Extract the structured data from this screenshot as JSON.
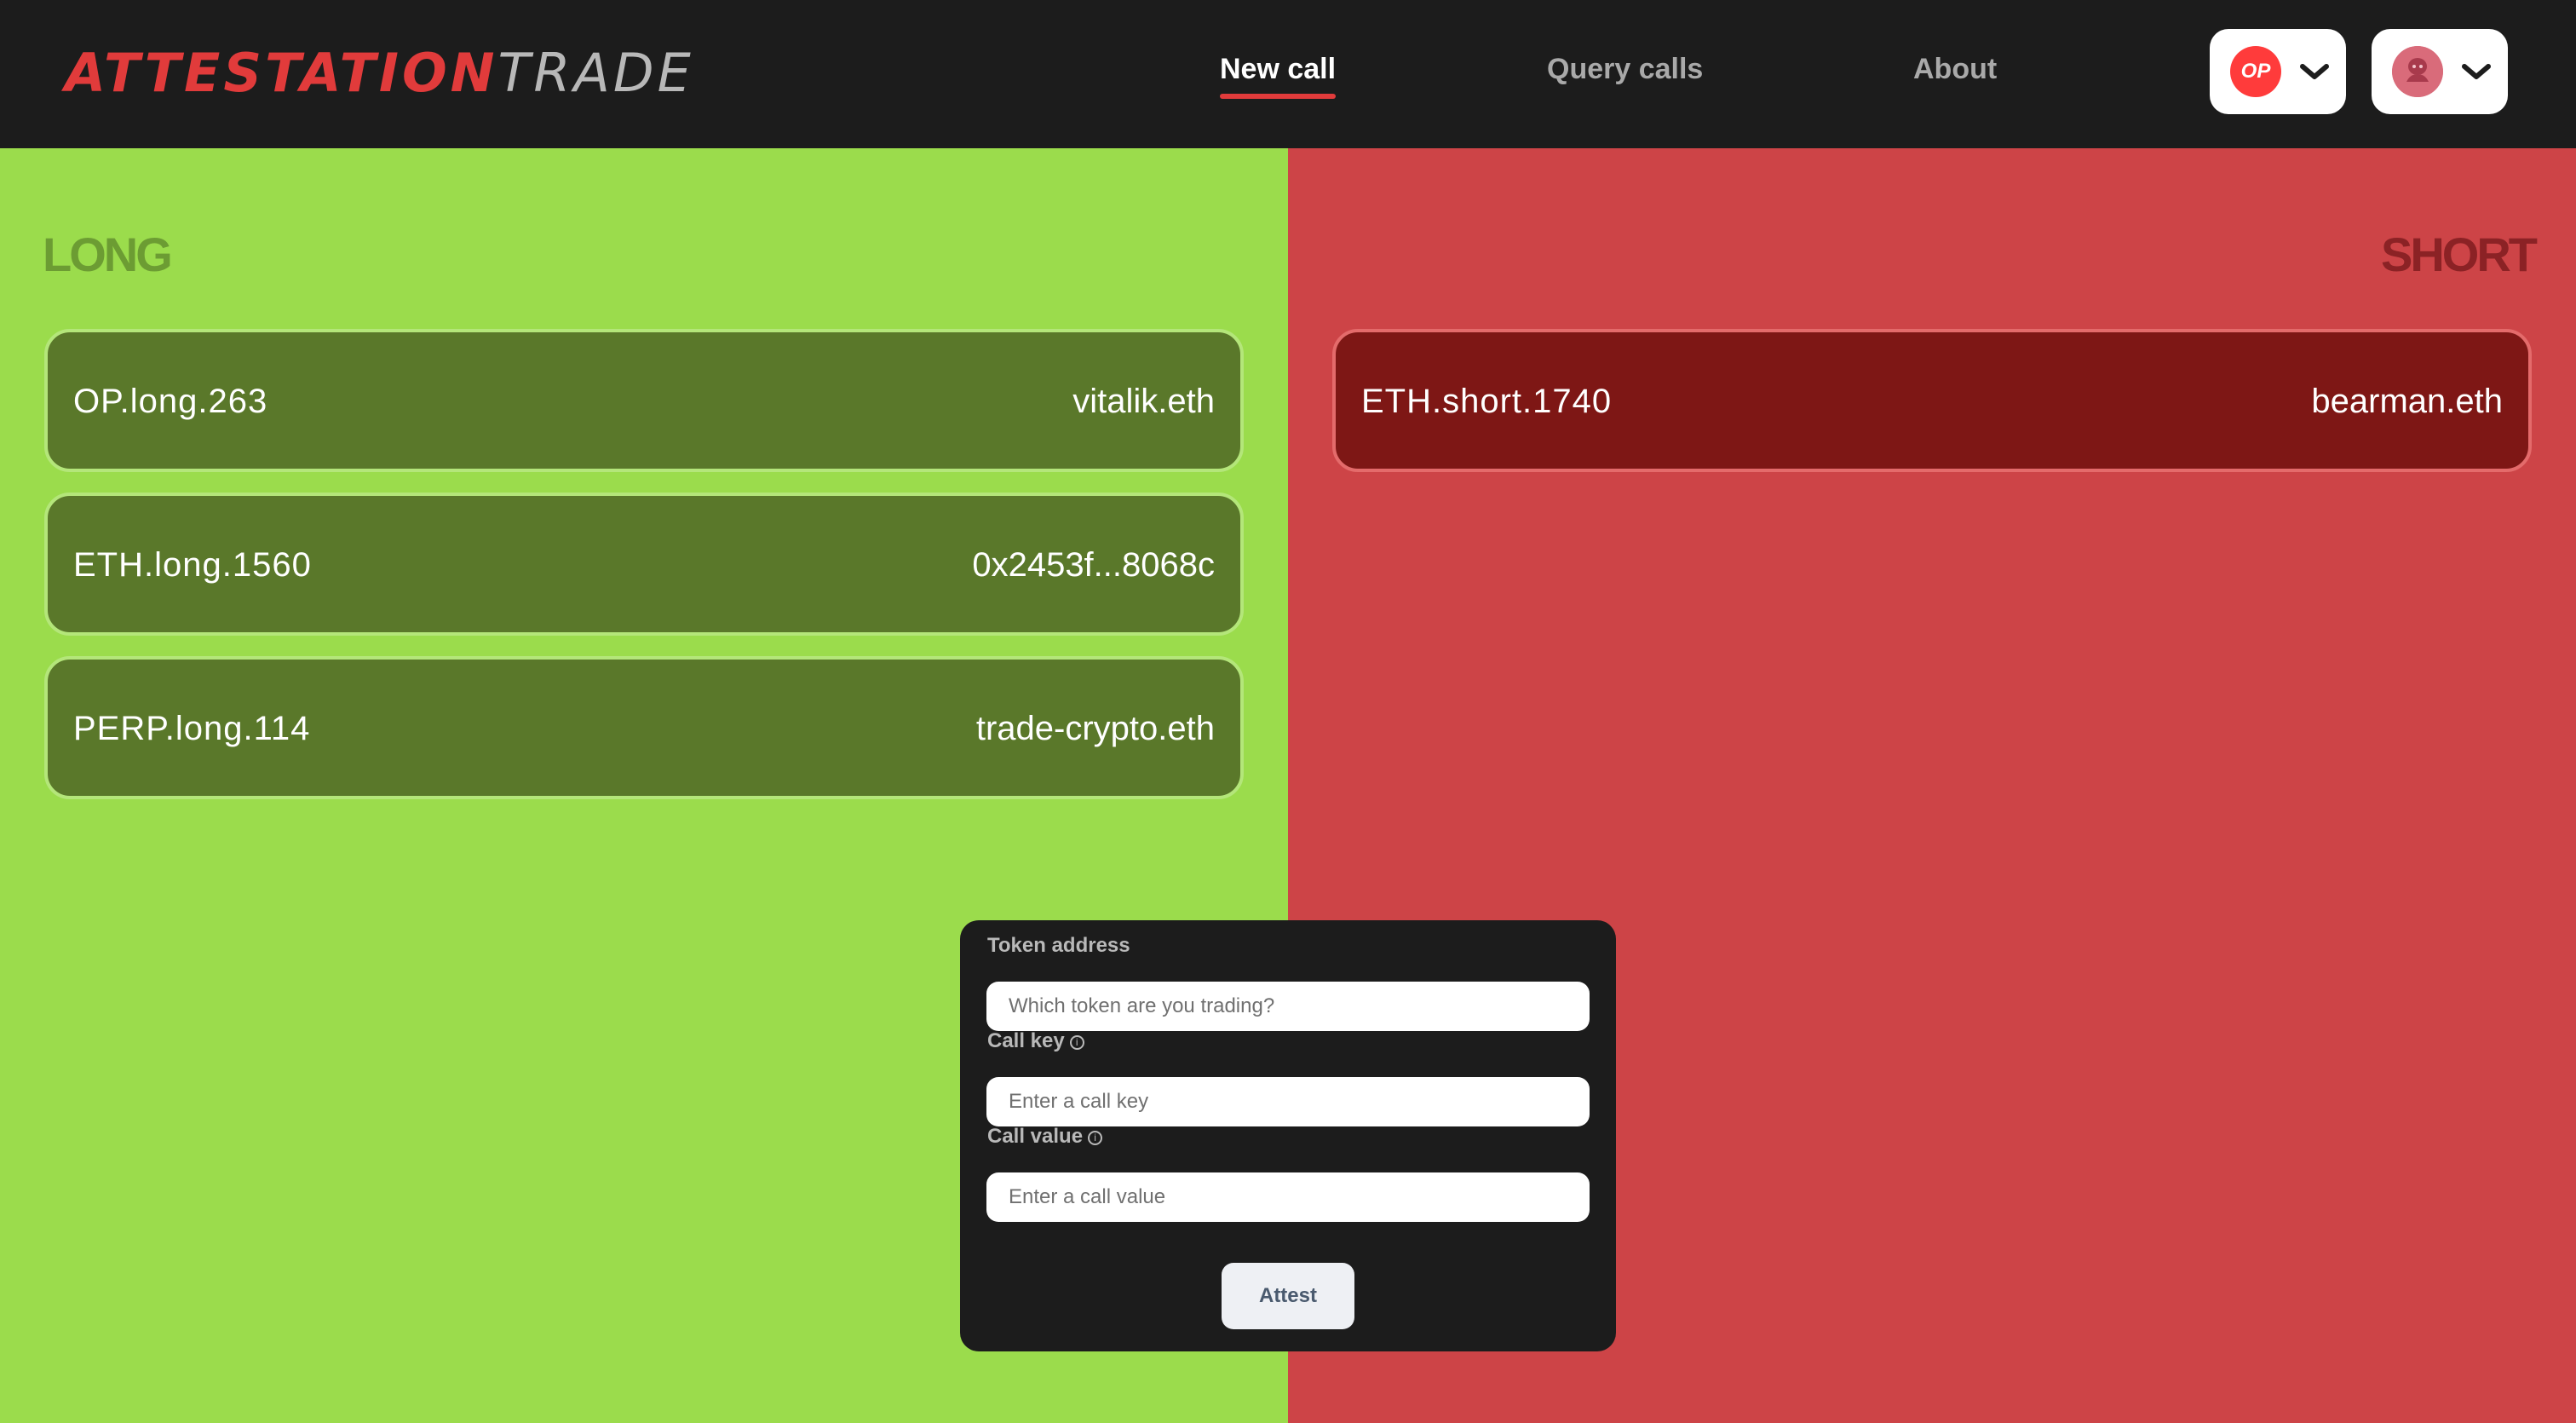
{
  "header": {
    "logo_primary": "ATTESTATION",
    "logo_secondary": "TRADE",
    "nav": {
      "new_call": "New call",
      "query_calls": "Query calls",
      "about": "About"
    },
    "chain_picker": {
      "badge": "OP",
      "icon": "optimism-logo-icon"
    },
    "account_picker": {
      "icon": "avatar-icon"
    }
  },
  "long": {
    "heading": "LONG",
    "calls": [
      {
        "key": "OP.long.263",
        "user": "vitalik.eth"
      },
      {
        "key": "ETH.long.1560",
        "user": "0x2453f...8068c"
      },
      {
        "key": "PERP.long.114",
        "user": "trade-crypto.eth"
      }
    ]
  },
  "short": {
    "heading": "SHORT",
    "calls": [
      {
        "key": "ETH.short.1740",
        "user": "bearman.eth"
      }
    ]
  },
  "form": {
    "token_label": "Token address",
    "token_placeholder": "Which token are you trading?",
    "key_label": "Call key",
    "key_placeholder": "Enter a call key",
    "value_label": "Call value",
    "value_placeholder": "Enter a call value",
    "submit_label": "Attest"
  },
  "colors": {
    "accent": "#e13b3b",
    "long_bg": "#9bdc4c",
    "long_card": "#5a782a",
    "short_bg": "#cd4447",
    "short_card": "#7e1715",
    "header_bg": "#1c1c1c"
  }
}
